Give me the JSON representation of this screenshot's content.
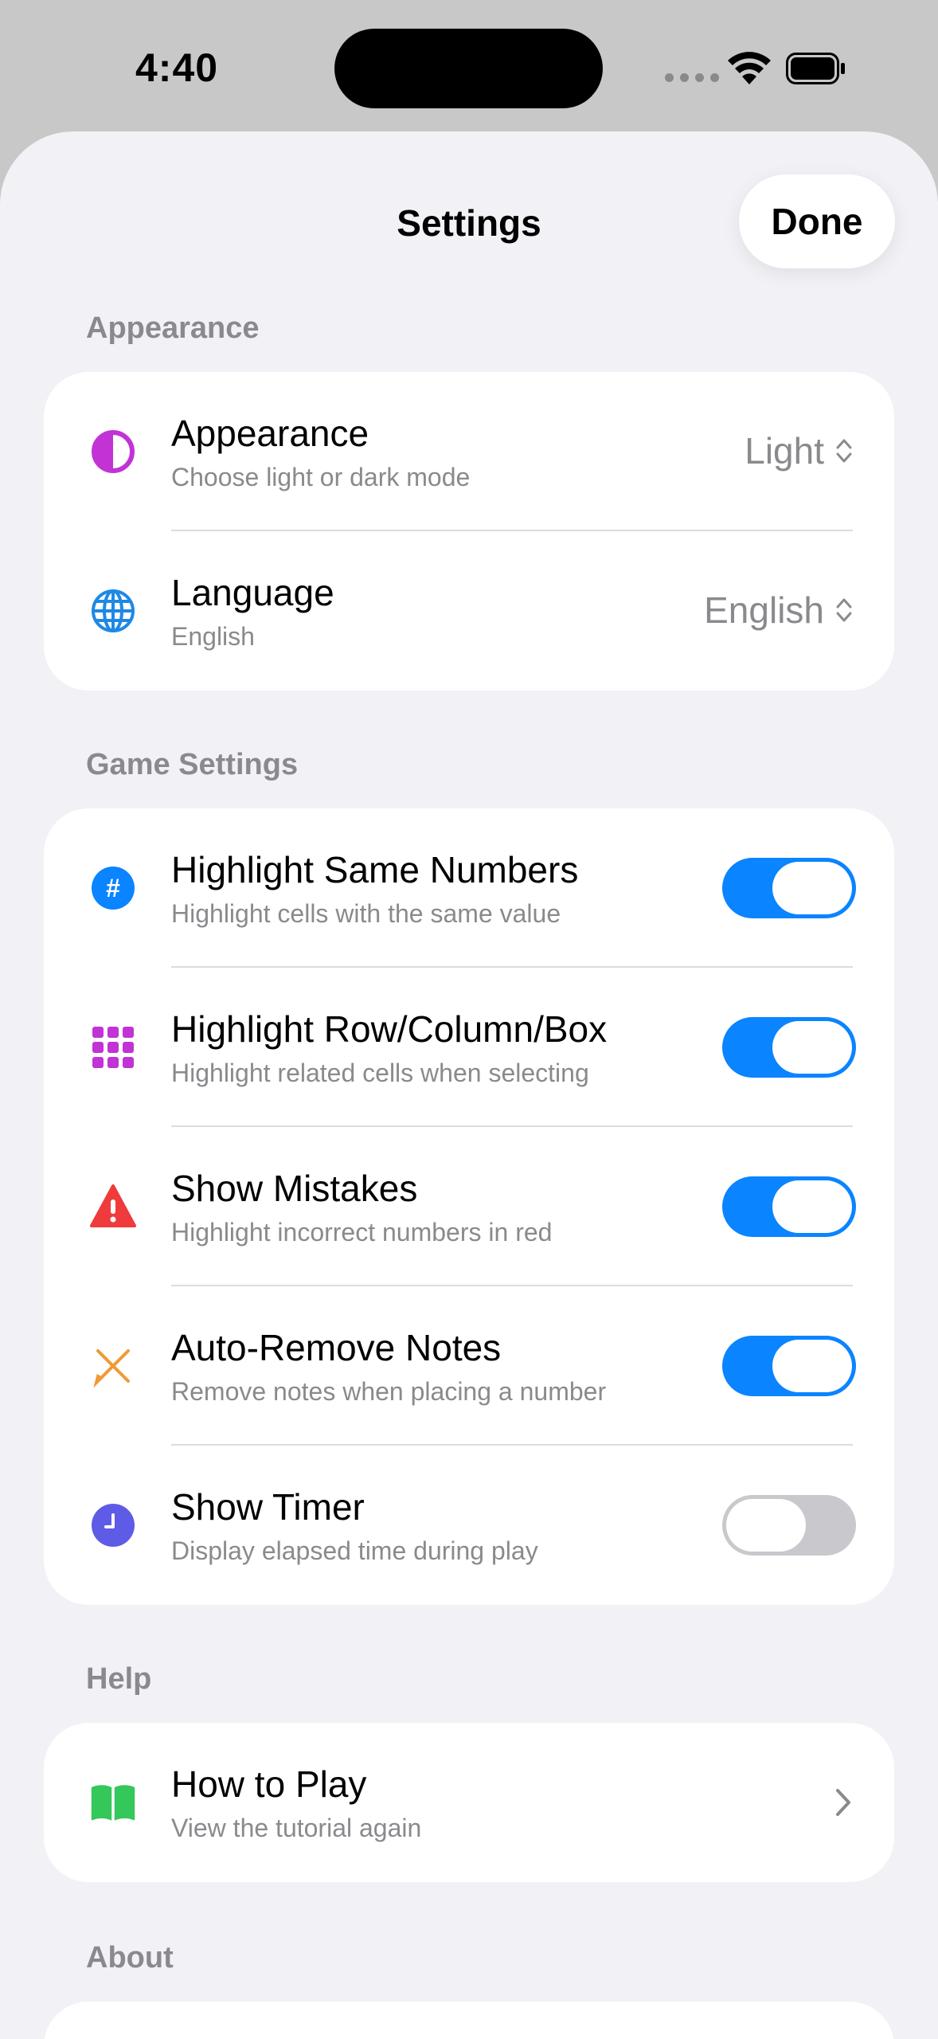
{
  "status": {
    "time": "4:40"
  },
  "header": {
    "title": "Settings",
    "done_label": "Done"
  },
  "sections": {
    "appearance": {
      "header": "Appearance",
      "rows": [
        {
          "title": "Appearance",
          "subtitle": "Choose light or dark mode",
          "value": "Light",
          "icon": "half-circle-icon",
          "icon_color": "#c233d6"
        },
        {
          "title": "Language",
          "subtitle": "English",
          "value": "English",
          "icon": "globe-icon",
          "icon_color": "#1e88e5"
        }
      ]
    },
    "game": {
      "header": "Game Settings",
      "rows": [
        {
          "title": "Highlight Same Numbers",
          "subtitle": "Highlight cells with the same value",
          "icon": "hash-icon",
          "icon_color": "#0a84ff",
          "toggle": true
        },
        {
          "title": "Highlight Row/Column/Box",
          "subtitle": "Highlight related cells when selecting",
          "icon": "grid-icon",
          "icon_color": "#c233d6",
          "toggle": true
        },
        {
          "title": "Show Mistakes",
          "subtitle": "Highlight incorrect numbers in red",
          "icon": "warning-icon",
          "icon_color": "#ef3b3b",
          "toggle": true
        },
        {
          "title": "Auto-Remove Notes",
          "subtitle": "Remove notes when placing a number",
          "icon": "pencil-cross-icon",
          "icon_color": "#f09a34",
          "toggle": true
        },
        {
          "title": "Show Timer",
          "subtitle": "Display elapsed time during play",
          "icon": "clock-icon",
          "icon_color": "#5e5ce6",
          "toggle": false
        }
      ]
    },
    "help": {
      "header": "Help",
      "rows": [
        {
          "title": "How to Play",
          "subtitle": "View the tutorial again",
          "icon": "book-icon",
          "icon_color": "#34c759"
        }
      ]
    },
    "about": {
      "header": "About"
    }
  },
  "colors": {
    "accent": "#0a84ff",
    "background": "#f1f1f6",
    "card": "#ffffff",
    "secondary_text": "#8a8a8e"
  }
}
